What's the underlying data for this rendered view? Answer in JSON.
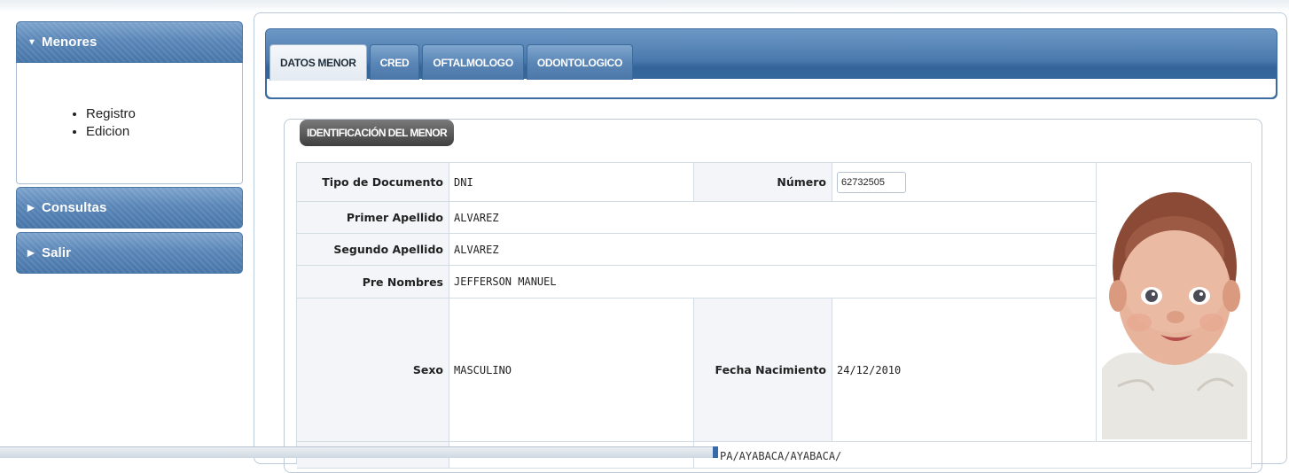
{
  "sidebar": {
    "sections": [
      {
        "label": "Menores",
        "expanded": true,
        "items": [
          {
            "label": "Registro"
          },
          {
            "label": "Edicion"
          }
        ]
      },
      {
        "label": "Consultas",
        "expanded": false
      },
      {
        "label": "Salir",
        "expanded": false
      }
    ]
  },
  "tabs": [
    {
      "label": "DATOS MENOR",
      "active": true
    },
    {
      "label": "CRED",
      "active": false
    },
    {
      "label": "OFTALMOLOGO",
      "active": false
    },
    {
      "label": "ODONTOLOGICO",
      "active": false
    }
  ],
  "section_title": "IDENTIFICACIÓN DEL MENOR",
  "form": {
    "tipo_documento": {
      "label": "Tipo de Documento",
      "value": "DNI"
    },
    "numero": {
      "label": "Número",
      "value": "62732505"
    },
    "primer_apellido": {
      "label": "Primer Apellido",
      "value": "ALVAREZ"
    },
    "segundo_apellido": {
      "label": "Segundo Apellido",
      "value": "ALVAREZ"
    },
    "pre_nombres": {
      "label": "Pre Nombres",
      "value": "JEFFERSON MANUEL"
    },
    "sexo": {
      "label": "Sexo",
      "value": "MASCULINO"
    },
    "fecha_nacimiento": {
      "label": "Fecha Nacimiento",
      "value": "24/12/2010"
    }
  },
  "partial_address": "PA/AYABACA/AYABACA/",
  "colors": {
    "accent_blue": "#4a79ad",
    "legend_bg": "#4f4f4f",
    "label_bg": "#f3f5f8"
  },
  "icons": {
    "expanded": "triangle-down",
    "collapsed": "triangle-right"
  }
}
